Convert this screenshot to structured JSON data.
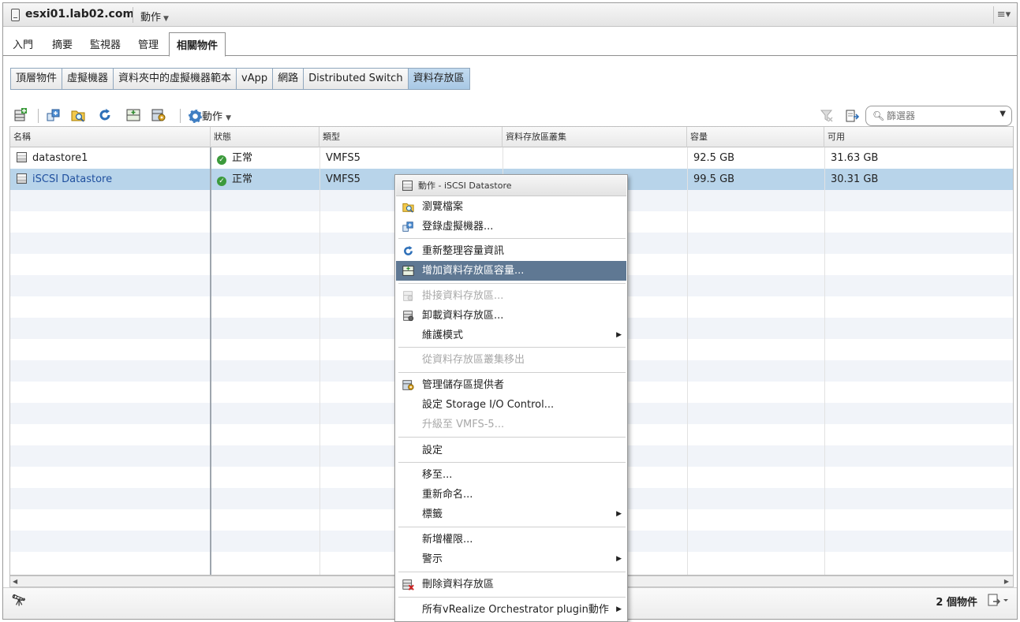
{
  "window": {
    "host_name": "esxi01.lab02.com",
    "actions_label": "動作",
    "caret": "▼"
  },
  "main_tabs": [
    "入門",
    "摘要",
    "監視器",
    "管理",
    "相關物件"
  ],
  "sub_tabs": [
    "頂層物件",
    "虛擬機器",
    "資料夾中的虛擬機器範本",
    "vApp",
    "網路",
    "Distributed Switch",
    "資料存放區"
  ],
  "toolbar": {
    "actions_label": "動作",
    "filter_placeholder": "篩選器"
  },
  "table": {
    "headers": [
      "名稱",
      "狀態",
      "類型",
      "資料存放區叢集",
      "容量",
      "可用"
    ],
    "rows": [
      {
        "name": "datastore1",
        "status": "正常",
        "type": "VMFS5",
        "cluster": "",
        "capacity": "92.5 GB",
        "free": "31.63 GB"
      },
      {
        "name": "iSCSI Datastore",
        "status": "正常",
        "type": "VMFS5",
        "cluster": "",
        "capacity": "99.5 GB",
        "free": "30.31 GB"
      }
    ]
  },
  "footer": {
    "count": "2 個物件"
  },
  "context_menu": {
    "title": "動作 - iSCSI Datastore",
    "items": [
      {
        "label": "瀏覽檔案"
      },
      {
        "label": "登錄虛擬機器..."
      },
      {
        "label": "重新整理容量資訊"
      },
      {
        "label": "增加資料存放區容量..."
      },
      {
        "label": "掛接資料存放區..."
      },
      {
        "label": "卸載資料存放區..."
      },
      {
        "label": "維護模式"
      },
      {
        "label": "從資料存放區叢集移出"
      },
      {
        "label": "管理儲存區提供者"
      },
      {
        "label": "設定 Storage I/O Control..."
      },
      {
        "label": "升級至 VMFS-5..."
      },
      {
        "label": "設定"
      },
      {
        "label": "移至..."
      },
      {
        "label": "重新命名..."
      },
      {
        "label": "標籤"
      },
      {
        "label": "新增權限..."
      },
      {
        "label": "警示"
      },
      {
        "label": "刪除資料存放區"
      },
      {
        "label": "所有vRealize Orchestrator plugin動作"
      }
    ]
  }
}
